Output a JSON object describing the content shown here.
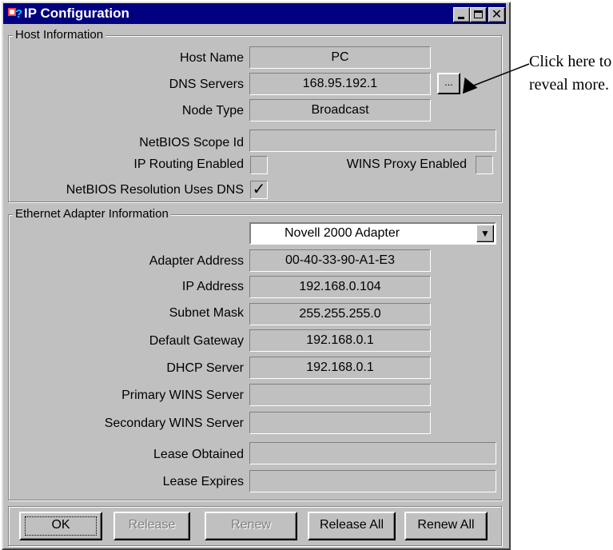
{
  "window": {
    "title": "IP Configuration"
  },
  "host_info": {
    "group_title": "Host Information",
    "host_name": {
      "label": "Host Name",
      "value": "PC"
    },
    "dns_servers": {
      "label": "DNS Servers",
      "value": "168.95.192.1",
      "more_label": "..."
    },
    "node_type": {
      "label": "Node Type",
      "value": "Broadcast"
    },
    "netbios_scope": {
      "label": "NetBIOS Scope Id",
      "value": ""
    },
    "ip_routing": {
      "label": "IP Routing Enabled",
      "checked": false
    },
    "wins_proxy": {
      "label": "WINS Proxy Enabled",
      "checked": false
    },
    "netbios_dns": {
      "label": "NetBIOS Resolution Uses DNS",
      "checked": true,
      "check_glyph": "✓"
    }
  },
  "adapter_info": {
    "group_title": "Ethernet  Adapter Information",
    "adapter_select": "Novell 2000 Adapter",
    "adapter_address": {
      "label": "Adapter Address",
      "value": "00-40-33-90-A1-E3"
    },
    "ip_address": {
      "label": "IP Address",
      "value": "192.168.0.104"
    },
    "subnet_mask": {
      "label": "Subnet Mask",
      "value": "255.255.255.0"
    },
    "default_gateway": {
      "label": "Default Gateway",
      "value": "192.168.0.1"
    },
    "dhcp_server": {
      "label": "DHCP Server",
      "value": "192.168.0.1"
    },
    "primary_wins": {
      "label": "Primary WINS Server",
      "value": ""
    },
    "secondary_wins": {
      "label": "Secondary WINS Server",
      "value": ""
    },
    "lease_obtained": {
      "label": "Lease Obtained",
      "value": ""
    },
    "lease_expires": {
      "label": "Lease Expires",
      "value": ""
    }
  },
  "buttons": {
    "ok": "OK",
    "release": "Release",
    "renew": "Renew",
    "release_all": "Release All",
    "renew_all": "Renew All"
  },
  "annotation": {
    "text": "Click here to reveal more."
  },
  "icons": {
    "app_icon": "network-question-icon",
    "minimize": "minimize-icon",
    "maximize": "maximize-icon",
    "close": "close-icon",
    "dropdown": "chevron-down-icon",
    "arrow": "arrow-icon"
  },
  "colors": {
    "titlebar": "#000080",
    "face": "#c0c0c0"
  }
}
